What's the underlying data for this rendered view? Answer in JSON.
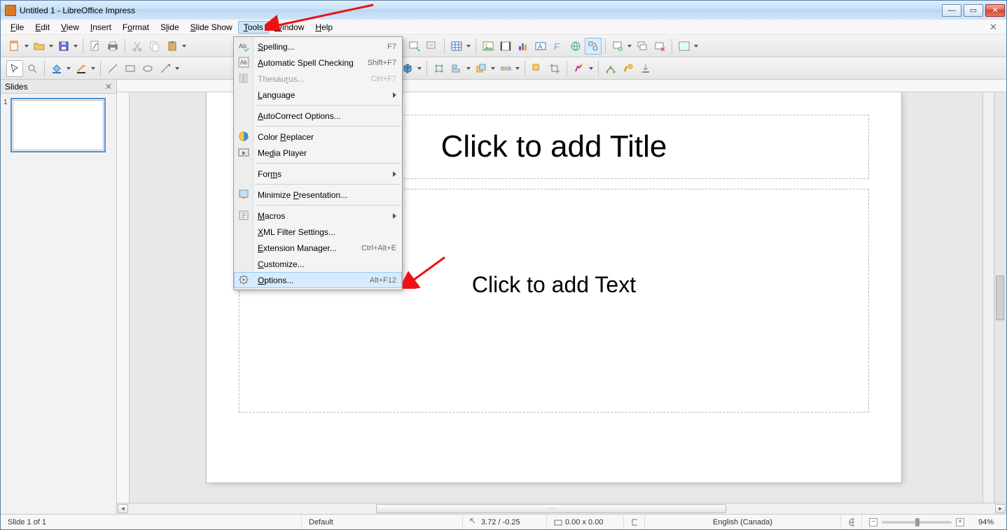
{
  "window": {
    "title": "Untitled 1 - LibreOffice Impress"
  },
  "menu": {
    "file": "File",
    "edit": "Edit",
    "view": "View",
    "insert": "Insert",
    "format": "Format",
    "slide": "Slide",
    "slideshow": "Slide Show",
    "tools": "Tools",
    "window": "Window",
    "help": "Help"
  },
  "dropdown": {
    "spelling": "Spelling...",
    "spelling_sc": "F7",
    "autospell": "Automatic Spell Checking",
    "autospell_sc": "Shift+F7",
    "thesaurus": "Thesaurus...",
    "thesaurus_sc": "Ctrl+F7",
    "language": "Language",
    "autocorrect": "AutoCorrect Options...",
    "colorreplacer": "Color Replacer",
    "mediaplayer": "Media Player",
    "forms": "Forms",
    "minimize": "Minimize Presentation...",
    "macros": "Macros",
    "xmlfilter": "XML Filter Settings...",
    "extmgr": "Extension Manager...",
    "extmgr_sc": "Ctrl+Alt+E",
    "customize": "Customize...",
    "options": "Options...",
    "options_sc": "Alt+F12"
  },
  "panel": {
    "slides": "Slides",
    "slide1_num": "1"
  },
  "slide": {
    "title_placeholder": "Click to add Title",
    "text_placeholder": "Click to add Text"
  },
  "status": {
    "slidecount": "Slide 1 of 1",
    "master": "Default",
    "coords": "3.72 / -0.25",
    "size": "0.00 x 0.00",
    "lang": "English (Canada)",
    "zoom": "94%"
  }
}
